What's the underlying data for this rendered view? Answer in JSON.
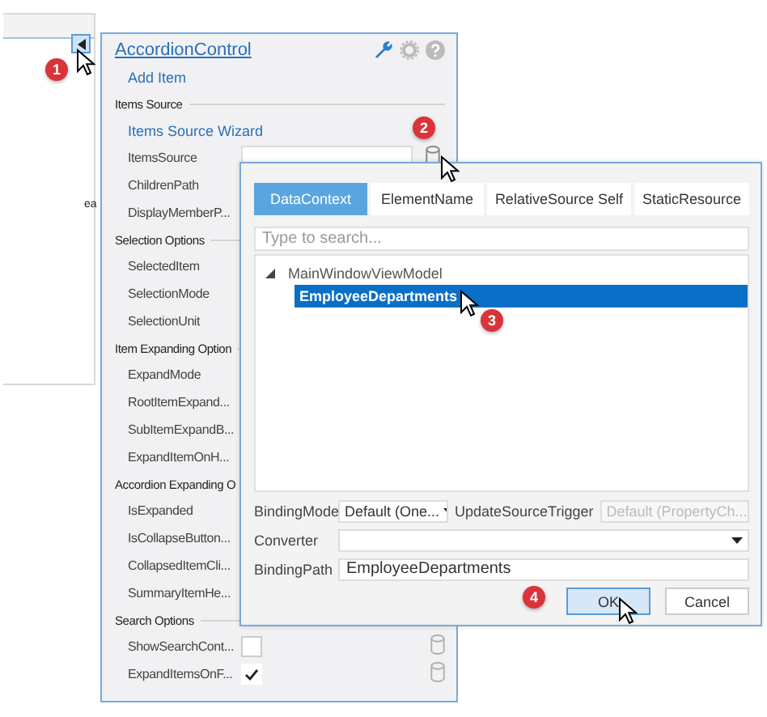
{
  "designer": {
    "fragment": "ea"
  },
  "smart_panel": {
    "title": "AccordionControl",
    "items": [
      {
        "kind": "link",
        "label": "Add Item"
      },
      {
        "kind": "section",
        "label": "Items Source"
      },
      {
        "kind": "link",
        "label": "Items Source Wizard"
      },
      {
        "kind": "input",
        "label": "ItemsSource"
      },
      {
        "kind": "property",
        "label": "ChildrenPath"
      },
      {
        "kind": "property",
        "label": "DisplayMemberP..."
      },
      {
        "kind": "section",
        "label": "Selection Options"
      },
      {
        "kind": "property",
        "label": "SelectedItem"
      },
      {
        "kind": "property",
        "label": "SelectionMode"
      },
      {
        "kind": "property",
        "label": "SelectionUnit"
      },
      {
        "kind": "section",
        "label": "Item Expanding Option"
      },
      {
        "kind": "property",
        "label": "ExpandMode"
      },
      {
        "kind": "property",
        "label": "RootItemExpand..."
      },
      {
        "kind": "property",
        "label": "SubItemExpandB..."
      },
      {
        "kind": "property",
        "label": "ExpandItemOnH..."
      },
      {
        "kind": "section",
        "label": "Accordion Expanding O"
      },
      {
        "kind": "property",
        "label": "IsExpanded"
      },
      {
        "kind": "property",
        "label": "IsCollapseButton..."
      },
      {
        "kind": "property",
        "label": "CollapsedItemCli..."
      },
      {
        "kind": "property",
        "label": "SummaryItemHe..."
      },
      {
        "kind": "section",
        "label": "Search Options"
      },
      {
        "kind": "checkbox",
        "label": "ShowSearchCont...",
        "checked": false
      },
      {
        "kind": "checkbox",
        "label": "ExpandItemsOnF...",
        "checked": true
      }
    ]
  },
  "binding_editor": {
    "tabs": [
      {
        "label": "DataContext",
        "selected": true
      },
      {
        "label": "ElementName",
        "selected": false
      },
      {
        "label": "RelativeSource Self",
        "selected": false
      },
      {
        "label": "StaticResource",
        "selected": false
      }
    ],
    "search": {
      "placeholder": "Type to search..."
    },
    "tree": [
      {
        "label": "MainWindowViewModel",
        "expanded": true,
        "selected": false,
        "children": [
          {
            "label": "EmployeeDepartments",
            "selected": true
          }
        ]
      }
    ],
    "rows": [
      {
        "fields": [
          {
            "label": "BindingMode",
            "kind": "combo",
            "value": "Default (One..."
          },
          {
            "label": "UpdateSourceTrigger",
            "kind": "combo",
            "value": "Default (PropertyCh...",
            "disabled": true
          }
        ]
      },
      {
        "fields": [
          {
            "label": "Converter",
            "kind": "combo"
          }
        ]
      },
      {
        "fields": [
          {
            "label": "BindingPath",
            "kind": "text",
            "value": "EmployeeDepartments"
          }
        ]
      }
    ],
    "buttons": [
      {
        "label": "OK",
        "hovered": true
      },
      {
        "label": "Cancel",
        "hovered": false
      }
    ]
  },
  "steps": [
    "1",
    "2",
    "3",
    "4"
  ]
}
